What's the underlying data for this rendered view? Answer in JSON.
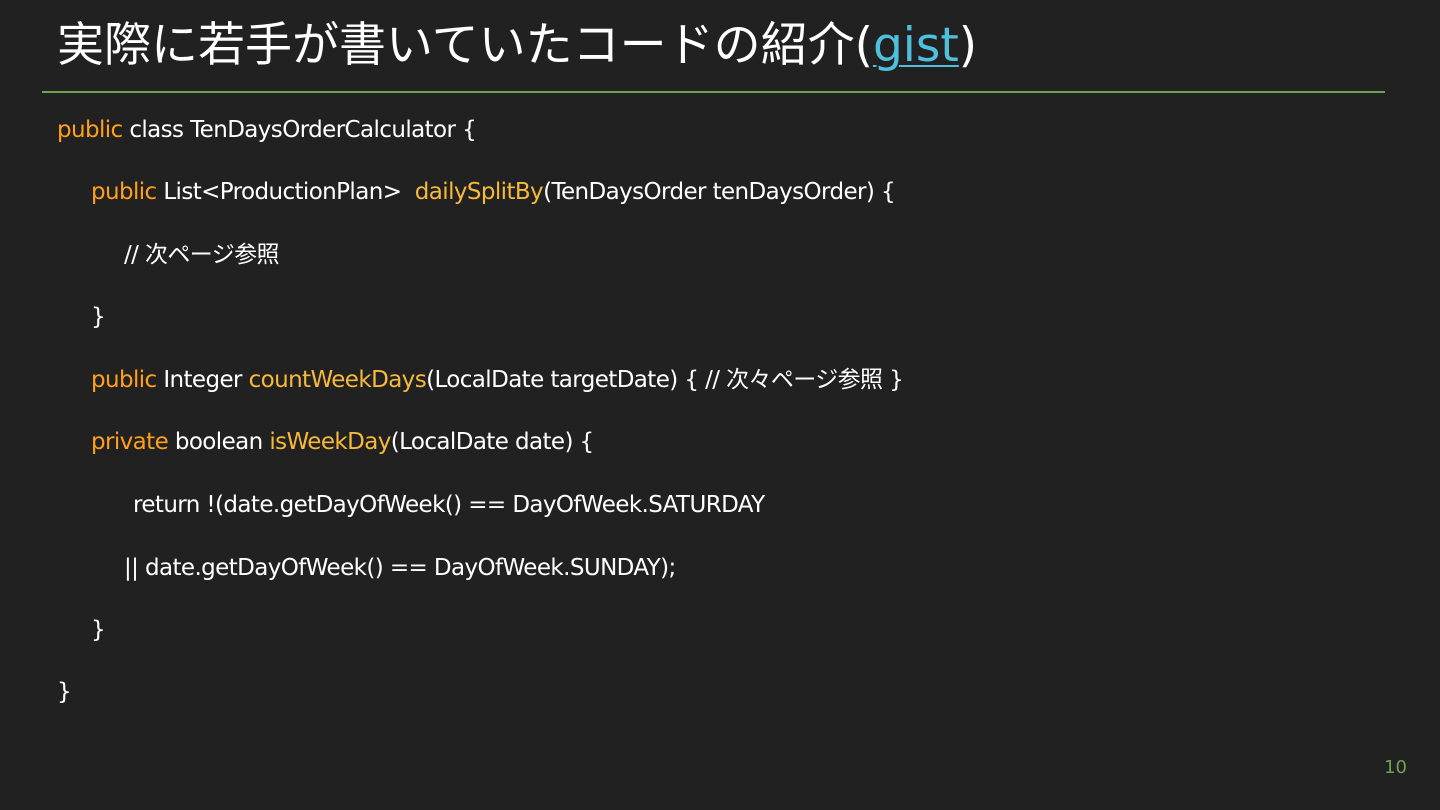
{
  "title": {
    "main": "実際に若手が書いていたコードの紹介",
    "paren_open": "(",
    "link": "gist",
    "paren_close": ")"
  },
  "code": {
    "l1": {
      "kw": "public",
      "text": " class TenDaysOrderCalculator {"
    },
    "l2": {
      "kw": "public",
      "text1": " List<ProductionPlan>  ",
      "fn": "dailySplitBy",
      "text2": "(TenDaysOrder tenDaysOrder) {"
    },
    "l3": {
      "text": "// 次ページ参照"
    },
    "l4": {
      "text": "}"
    },
    "l5": {
      "kw": "public",
      "text1": " Integer ",
      "fn": "countWeekDays",
      "text2": "(LocalDate targetDate) { // 次々ページ参照 }"
    },
    "l6": {
      "kw": "private",
      "text1": " boolean ",
      "fn": "isWeekDay",
      "text2": "(LocalDate date) {"
    },
    "l7": {
      "text": "return !(date.getDayOfWeek() == DayOfWeek.SATURDAY"
    },
    "l8": {
      "text": "|| date.getDayOfWeek() == DayOfWeek.SUNDAY);"
    },
    "l9": {
      "text": "}"
    },
    "l10": {
      "text": "}"
    }
  },
  "slide_number": "10",
  "colors": {
    "background": "#212121",
    "keyword": "#ff9f1c",
    "method": "#f6b93b",
    "link": "#4fc0dc",
    "accent": "#6fa352"
  }
}
